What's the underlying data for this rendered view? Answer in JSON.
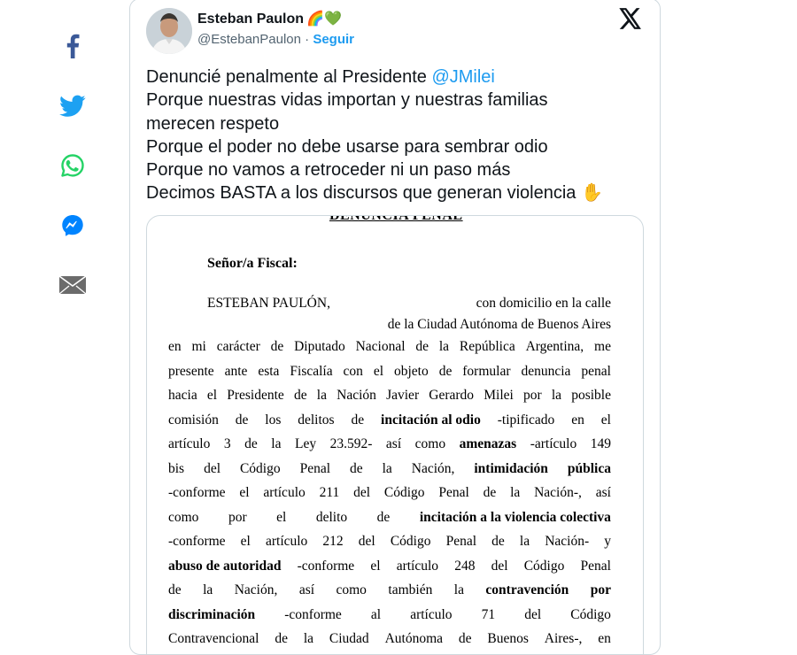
{
  "share_rail": {
    "items": [
      {
        "name": "facebook",
        "color": "#3b5998"
      },
      {
        "name": "twitter",
        "color": "#1da1f2"
      },
      {
        "name": "whatsapp",
        "color": "#25d366"
      },
      {
        "name": "messenger",
        "color": "#0084ff"
      },
      {
        "name": "email",
        "color": "#555555"
      }
    ]
  },
  "tweet": {
    "author_name": "Esteban Paulon",
    "author_emoji": "🌈💚",
    "handle": "@EstebanPaulon",
    "separator": " · ",
    "follow_label": "Seguir",
    "text_lines": [
      {
        "pre": "Denuncié penalmente al Presidente ",
        "mention": "@JMilei"
      },
      {
        "pre": "Porque nuestras vidas importan y nuestras familias"
      },
      {
        "pre": "merecen respeto"
      },
      {
        "pre": "Porque el poder no debe usarse para sembrar odio"
      },
      {
        "pre": "Porque no vamos a retroceder ni un paso más"
      },
      {
        "pre": "Decimos BASTA a los discursos que generan violencia ",
        "emoji": "✋"
      }
    ],
    "colors": {
      "link": "#1d9bf0",
      "text": "#0f1419",
      "muted": "#536471"
    }
  },
  "document": {
    "title": "DENUNCIA PENAL",
    "greeting": "Señor/a Fiscal:",
    "intro_name": "ESTEBAN PAULÓN,",
    "intro_right": "con domicilio en la calle",
    "line_city": "de la Ciudad Autónoma de Buenos Aires",
    "lines": [
      [
        "en",
        "mi",
        "carácter",
        "de",
        "Diputado",
        "Nacional",
        "de",
        "la",
        "República",
        "Argentina,",
        "me"
      ],
      [
        "presente",
        "ante",
        "esta",
        "Fiscalía",
        "con",
        "el",
        "objeto",
        "de",
        "formular",
        "denuncia",
        "penal"
      ],
      [
        "hacia",
        "el",
        "Presidente",
        "de",
        "la",
        "Nación",
        "Javier",
        "Gerardo",
        "Milei",
        "por",
        "la",
        "posible"
      ],
      [
        "comisión",
        "de",
        "los",
        "delitos",
        "de",
        "**incitación al odio**",
        "-tipificado",
        "en",
        "el"
      ],
      [
        "artículo",
        "3",
        "de",
        "la",
        "Ley",
        "23.592-",
        "así",
        "como",
        "**amenazas**",
        "-artículo",
        "149"
      ],
      [
        "bis",
        "del",
        "Código",
        "Penal",
        "de",
        "la",
        "Nación,",
        "**intimidación**",
        "**pública**"
      ],
      [
        "-conforme",
        "el",
        "artículo",
        "211",
        "del",
        "Código",
        "Penal",
        "de",
        "la",
        "Nación-,",
        "así"
      ],
      [
        "como",
        "por",
        "el",
        "delito",
        "de",
        "**incitación a la violencia colectiva**"
      ],
      [
        "-conforme",
        "el",
        "artículo",
        "212",
        "del",
        "Código",
        "Penal",
        "de",
        "la",
        "Nación-",
        "y"
      ],
      [
        "**abuso de autoridad**",
        "-conforme",
        "el",
        "artículo",
        "248",
        "del",
        "Código",
        "Penal"
      ],
      [
        "de",
        "la",
        "Nación,",
        "así",
        "como",
        "también",
        "la",
        "**contravención**",
        "**por**"
      ],
      [
        "**discriminación**",
        "-conforme",
        "al",
        "artículo",
        "71",
        "del",
        "Código"
      ],
      [
        "Contravencional",
        "de",
        "la",
        "Ciudad",
        "Autónoma",
        "de",
        "Buenos",
        "Aires-,",
        "en"
      ]
    ]
  }
}
